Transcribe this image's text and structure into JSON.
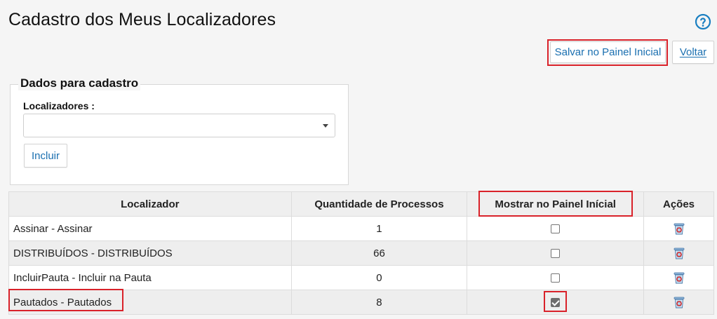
{
  "page": {
    "title": "Cadastro dos Meus Localizadores",
    "help_icon": "question-circle-icon"
  },
  "actions": {
    "save_label": "Salvar no Painel Inicial",
    "back_label": "Voltar"
  },
  "form": {
    "legend": "Dados para cadastro",
    "localizadores_label": "Localizadores :",
    "localizadores_value": "",
    "include_label": "Incluir"
  },
  "table": {
    "headers": [
      "Localizador",
      "Quantidade de Processos",
      "Mostrar no Painel Inícial",
      "Ações"
    ],
    "rows": [
      {
        "localizador": "Assinar - Assinar",
        "quantidade": "1",
        "mostrar": false,
        "action_icon": "trash-icon"
      },
      {
        "localizador": "DISTRIBUÍDOS - DISTRIBUÍDOS",
        "quantidade": "66",
        "mostrar": false,
        "action_icon": "trash-icon"
      },
      {
        "localizador": "IncluirPauta - Incluir na Pauta",
        "quantidade": "0",
        "mostrar": false,
        "action_icon": "trash-icon"
      },
      {
        "localizador": "Pautados - Pautados",
        "quantidade": "8",
        "mostrar": true,
        "action_icon": "trash-icon"
      }
    ]
  },
  "colors": {
    "link": "#1a6fb0",
    "highlight": "#d9222a",
    "help": "#1a7fc1"
  }
}
